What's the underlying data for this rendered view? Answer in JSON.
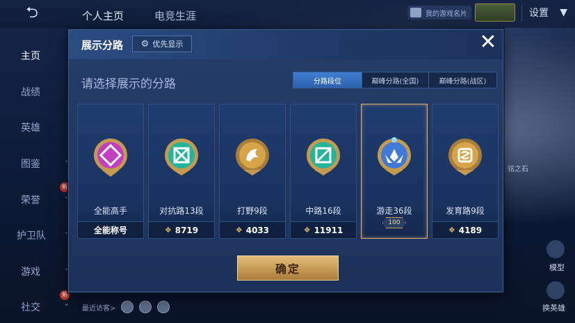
{
  "topbar": {
    "tabs": [
      "个人主页",
      "电竞生涯"
    ],
    "card_chip": "我的游戏名片",
    "settings_label": "设置"
  },
  "sidebar": {
    "items": [
      {
        "label": "主页",
        "active": true,
        "chevron": false
      },
      {
        "label": "战绩",
        "active": false,
        "chevron": false
      },
      {
        "label": "英雄",
        "active": false,
        "chevron": false
      },
      {
        "label": "图鉴",
        "active": false,
        "chevron": true
      },
      {
        "label": "荣誉",
        "active": false,
        "chevron": true
      },
      {
        "label": "护卫队",
        "active": false,
        "chevron": true
      },
      {
        "label": "游戏",
        "active": false,
        "chevron": true
      },
      {
        "label": "社交",
        "active": false,
        "chevron": true
      }
    ],
    "new_badge": "新"
  },
  "recent_visitors_label": "最近访客>",
  "right_side": {
    "stone_label": "铭之石",
    "model_label": "模型",
    "swap_hero_label": "换英雄"
  },
  "dialog": {
    "title": "展示分路",
    "priority_label": "优先显示",
    "subtitle": "请选择展示的分路",
    "segments": [
      {
        "label": "分路段位",
        "active": true
      },
      {
        "label": "巅峰分路(全国)",
        "active": false
      },
      {
        "label": "巅峰分路(战区)",
        "active": false
      }
    ],
    "cards": [
      {
        "label": "全能高手",
        "foot": "全能称号",
        "foot_icon": false,
        "emblem_color": "#c23fc0",
        "selected": false
      },
      {
        "label": "对抗路13段",
        "foot": "8719",
        "foot_icon": true,
        "emblem_color": "#23b59a",
        "selected": false
      },
      {
        "label": "打野9段",
        "foot": "4033",
        "foot_icon": true,
        "emblem_color": "#c98d2e",
        "selected": false
      },
      {
        "label": "中路16段",
        "foot": "11911",
        "foot_icon": true,
        "emblem_color": "#23b59a",
        "selected": false
      },
      {
        "label": "游走36段",
        "foot": "100",
        "foot_icon": false,
        "emblem_color": "#3f7ad8",
        "selected": true
      },
      {
        "label": "发育路9段",
        "foot": "4189",
        "foot_icon": true,
        "emblem_color": "#c98d2e",
        "selected": false
      }
    ],
    "confirm_label": "确定"
  }
}
